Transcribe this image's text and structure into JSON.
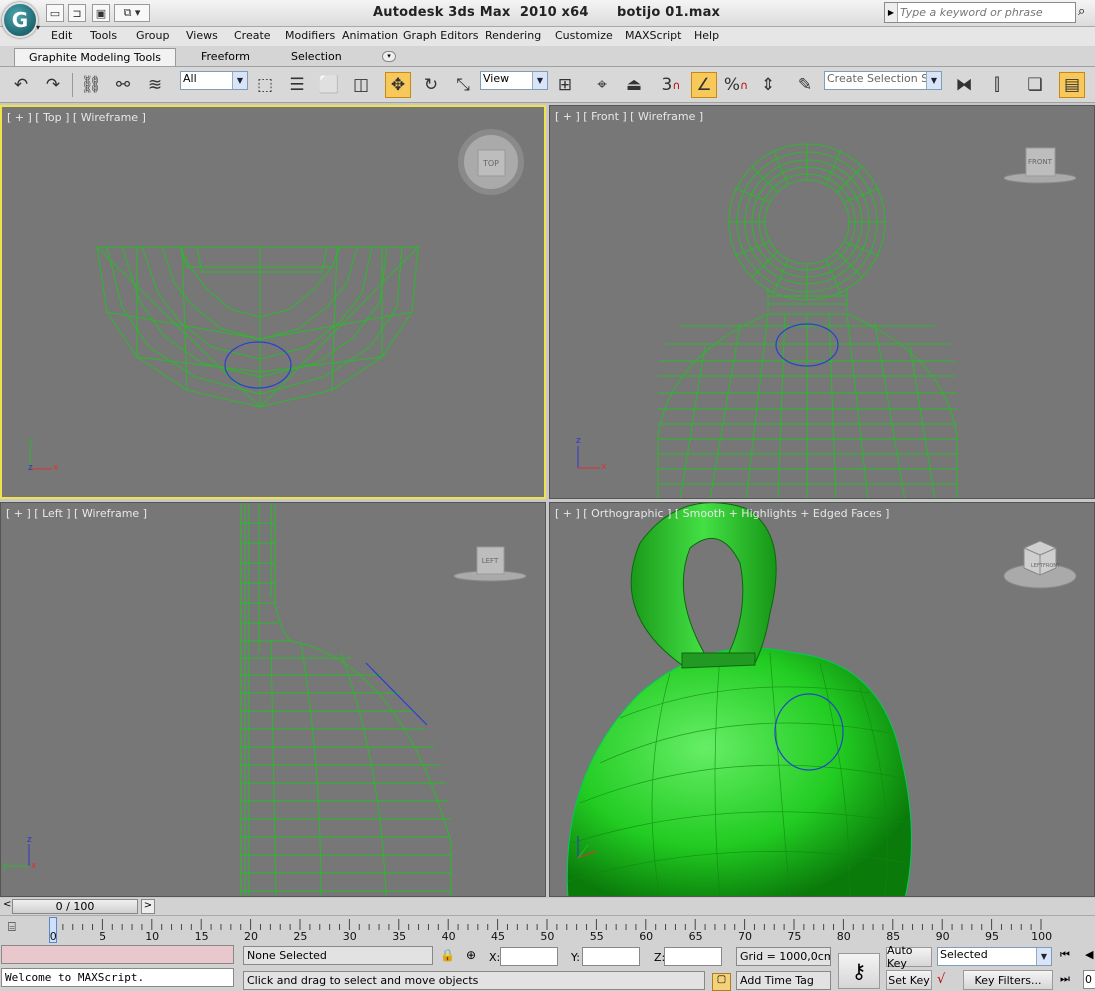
{
  "window": {
    "title": "Autodesk 3ds Max  2010 x64      botijo 01.max",
    "search_placeholder": "Type a keyword or phrase"
  },
  "menu": [
    "Edit",
    "Tools",
    "Group",
    "Views",
    "Create",
    "Modifiers",
    "Animation",
    "Graph Editors",
    "Rendering",
    "Customize",
    "MAXScript",
    "Help"
  ],
  "ribbon": {
    "tabs": [
      "Graphite Modeling Tools",
      "Freeform",
      "Selection"
    ]
  },
  "toolbar": {
    "selection_filter": "All",
    "reference_coord": "View",
    "named_selection": "Create Selection Se",
    "snap_number": "3",
    "percent_symbol": "%"
  },
  "viewports": {
    "top": {
      "label": "[ + ] [ Top ] [ Wireframe ]",
      "cube_label": "TOP",
      "axes": [
        "y",
        "z",
        "x"
      ]
    },
    "front": {
      "label": "[ + ] [ Front ] [ Wireframe ]",
      "cube_label": "FRONT",
      "axes": [
        "z",
        "y",
        "x"
      ]
    },
    "left": {
      "label": "[ + ] [ Left ] [ Wireframe ]",
      "cube_label": "LEFT",
      "axes": [
        "z",
        "y",
        "x"
      ]
    },
    "ortho": {
      "label": "[ + ] [ Orthographic ] [ Smooth + Highlights + Edged Faces ]",
      "cube_faces": [
        "TOP",
        "LEFT",
        "FRONT"
      ]
    }
  },
  "timeline": {
    "slider_text": "0 / 100",
    "ticks": [
      "0",
      "5",
      "10",
      "15",
      "20",
      "25",
      "30",
      "35",
      "40",
      "45",
      "50",
      "55",
      "60",
      "65",
      "70",
      "75",
      "80",
      "85",
      "90",
      "95",
      "100"
    ]
  },
  "status": {
    "maxscript_output": "Welcome to MAXScript.",
    "selection": "None Selected",
    "prompt": "Click and drag to select and move objects",
    "x_label": "X:",
    "y_label": "Y:",
    "z_label": "Z:",
    "grid": "Grid = 1000,0cm",
    "add_time_tag": "Add Time Tag",
    "auto_key": "Auto Key",
    "set_key": "Set Key",
    "key_mode": "Selected",
    "key_filters": "Key Filters...",
    "frame_field": "0"
  },
  "colors": {
    "wire": "#2db82d",
    "viewport_bg": "#777777",
    "active_border": "#f0e24a",
    "shaded_green": "#22c822",
    "selection_circle": "#2244cc"
  }
}
